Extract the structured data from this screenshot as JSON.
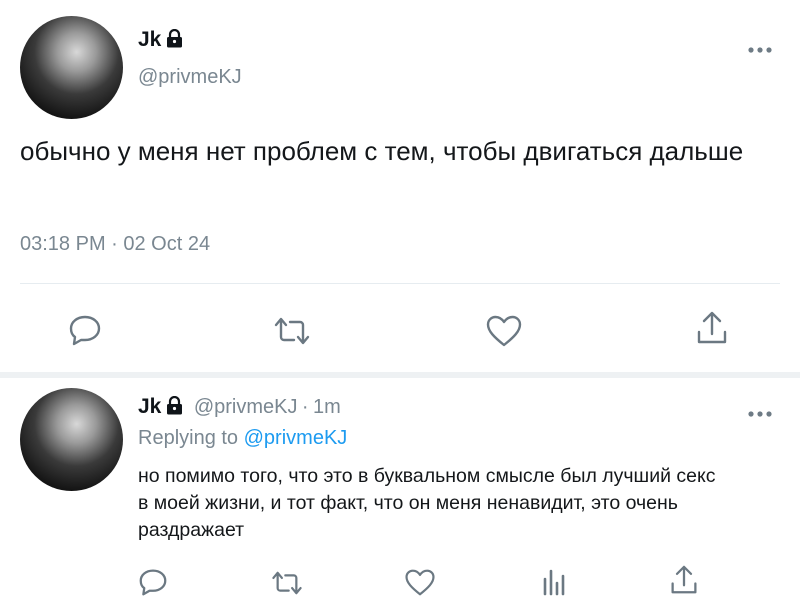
{
  "main_tweet": {
    "display_name": "Jk",
    "handle": "@privmeKJ",
    "text": "обычно у меня нет проблем с тем, чтобы двигаться дальше",
    "timestamp": "03:18 PM · 02 Oct 24",
    "more_icon": "more-horizontal-icon",
    "actions": [
      "reply-icon",
      "retweet-icon",
      "like-icon",
      "share-icon"
    ]
  },
  "reply_tweet": {
    "display_name": "Jk",
    "handle": "@privmeKJ",
    "separator": "·",
    "age": "1m",
    "replying_label": "Replying to",
    "replying_handle": "@privmeKJ",
    "text": "но помимо того, что это в буквальном смысле был лучший секс в моей жизни, и тот факт, что он меня ненавидит, это очень раздражает",
    "actions": [
      "reply-icon",
      "retweet-icon",
      "like-icon",
      "analytics-icon",
      "share-icon"
    ]
  },
  "colors": {
    "link": "#1d9bf0",
    "secondary_text": "#7a8791",
    "divider": "#e6ecf0",
    "icon": "#6b7882"
  }
}
